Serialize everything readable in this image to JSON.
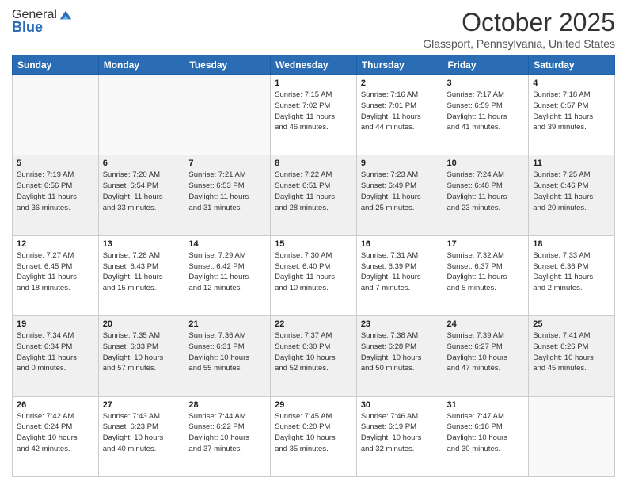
{
  "header": {
    "logo_general": "General",
    "logo_blue": "Blue",
    "month_title": "October 2025",
    "location": "Glassport, Pennsylvania, United States"
  },
  "weekdays": [
    "Sunday",
    "Monday",
    "Tuesday",
    "Wednesday",
    "Thursday",
    "Friday",
    "Saturday"
  ],
  "weeks": [
    [
      {
        "day": "",
        "info": "",
        "empty": true
      },
      {
        "day": "",
        "info": "",
        "empty": true
      },
      {
        "day": "",
        "info": "",
        "empty": true
      },
      {
        "day": "1",
        "info": "Sunrise: 7:15 AM\nSunset: 7:02 PM\nDaylight: 11 hours\nand 46 minutes.",
        "empty": false
      },
      {
        "day": "2",
        "info": "Sunrise: 7:16 AM\nSunset: 7:01 PM\nDaylight: 11 hours\nand 44 minutes.",
        "empty": false
      },
      {
        "day": "3",
        "info": "Sunrise: 7:17 AM\nSunset: 6:59 PM\nDaylight: 11 hours\nand 41 minutes.",
        "empty": false
      },
      {
        "day": "4",
        "info": "Sunrise: 7:18 AM\nSunset: 6:57 PM\nDaylight: 11 hours\nand 39 minutes.",
        "empty": false
      }
    ],
    [
      {
        "day": "5",
        "info": "Sunrise: 7:19 AM\nSunset: 6:56 PM\nDaylight: 11 hours\nand 36 minutes.",
        "empty": false
      },
      {
        "day": "6",
        "info": "Sunrise: 7:20 AM\nSunset: 6:54 PM\nDaylight: 11 hours\nand 33 minutes.",
        "empty": false
      },
      {
        "day": "7",
        "info": "Sunrise: 7:21 AM\nSunset: 6:53 PM\nDaylight: 11 hours\nand 31 minutes.",
        "empty": false
      },
      {
        "day": "8",
        "info": "Sunrise: 7:22 AM\nSunset: 6:51 PM\nDaylight: 11 hours\nand 28 minutes.",
        "empty": false
      },
      {
        "day": "9",
        "info": "Sunrise: 7:23 AM\nSunset: 6:49 PM\nDaylight: 11 hours\nand 25 minutes.",
        "empty": false
      },
      {
        "day": "10",
        "info": "Sunrise: 7:24 AM\nSunset: 6:48 PM\nDaylight: 11 hours\nand 23 minutes.",
        "empty": false
      },
      {
        "day": "11",
        "info": "Sunrise: 7:25 AM\nSunset: 6:46 PM\nDaylight: 11 hours\nand 20 minutes.",
        "empty": false
      }
    ],
    [
      {
        "day": "12",
        "info": "Sunrise: 7:27 AM\nSunset: 6:45 PM\nDaylight: 11 hours\nand 18 minutes.",
        "empty": false
      },
      {
        "day": "13",
        "info": "Sunrise: 7:28 AM\nSunset: 6:43 PM\nDaylight: 11 hours\nand 15 minutes.",
        "empty": false
      },
      {
        "day": "14",
        "info": "Sunrise: 7:29 AM\nSunset: 6:42 PM\nDaylight: 11 hours\nand 12 minutes.",
        "empty": false
      },
      {
        "day": "15",
        "info": "Sunrise: 7:30 AM\nSunset: 6:40 PM\nDaylight: 11 hours\nand 10 minutes.",
        "empty": false
      },
      {
        "day": "16",
        "info": "Sunrise: 7:31 AM\nSunset: 6:39 PM\nDaylight: 11 hours\nand 7 minutes.",
        "empty": false
      },
      {
        "day": "17",
        "info": "Sunrise: 7:32 AM\nSunset: 6:37 PM\nDaylight: 11 hours\nand 5 minutes.",
        "empty": false
      },
      {
        "day": "18",
        "info": "Sunrise: 7:33 AM\nSunset: 6:36 PM\nDaylight: 11 hours\nand 2 minutes.",
        "empty": false
      }
    ],
    [
      {
        "day": "19",
        "info": "Sunrise: 7:34 AM\nSunset: 6:34 PM\nDaylight: 11 hours\nand 0 minutes.",
        "empty": false
      },
      {
        "day": "20",
        "info": "Sunrise: 7:35 AM\nSunset: 6:33 PM\nDaylight: 10 hours\nand 57 minutes.",
        "empty": false
      },
      {
        "day": "21",
        "info": "Sunrise: 7:36 AM\nSunset: 6:31 PM\nDaylight: 10 hours\nand 55 minutes.",
        "empty": false
      },
      {
        "day": "22",
        "info": "Sunrise: 7:37 AM\nSunset: 6:30 PM\nDaylight: 10 hours\nand 52 minutes.",
        "empty": false
      },
      {
        "day": "23",
        "info": "Sunrise: 7:38 AM\nSunset: 6:28 PM\nDaylight: 10 hours\nand 50 minutes.",
        "empty": false
      },
      {
        "day": "24",
        "info": "Sunrise: 7:39 AM\nSunset: 6:27 PM\nDaylight: 10 hours\nand 47 minutes.",
        "empty": false
      },
      {
        "day": "25",
        "info": "Sunrise: 7:41 AM\nSunset: 6:26 PM\nDaylight: 10 hours\nand 45 minutes.",
        "empty": false
      }
    ],
    [
      {
        "day": "26",
        "info": "Sunrise: 7:42 AM\nSunset: 6:24 PM\nDaylight: 10 hours\nand 42 minutes.",
        "empty": false
      },
      {
        "day": "27",
        "info": "Sunrise: 7:43 AM\nSunset: 6:23 PM\nDaylight: 10 hours\nand 40 minutes.",
        "empty": false
      },
      {
        "day": "28",
        "info": "Sunrise: 7:44 AM\nSunset: 6:22 PM\nDaylight: 10 hours\nand 37 minutes.",
        "empty": false
      },
      {
        "day": "29",
        "info": "Sunrise: 7:45 AM\nSunset: 6:20 PM\nDaylight: 10 hours\nand 35 minutes.",
        "empty": false
      },
      {
        "day": "30",
        "info": "Sunrise: 7:46 AM\nSunset: 6:19 PM\nDaylight: 10 hours\nand 32 minutes.",
        "empty": false
      },
      {
        "day": "31",
        "info": "Sunrise: 7:47 AM\nSunset: 6:18 PM\nDaylight: 10 hours\nand 30 minutes.",
        "empty": false
      },
      {
        "day": "",
        "info": "",
        "empty": true
      }
    ]
  ]
}
